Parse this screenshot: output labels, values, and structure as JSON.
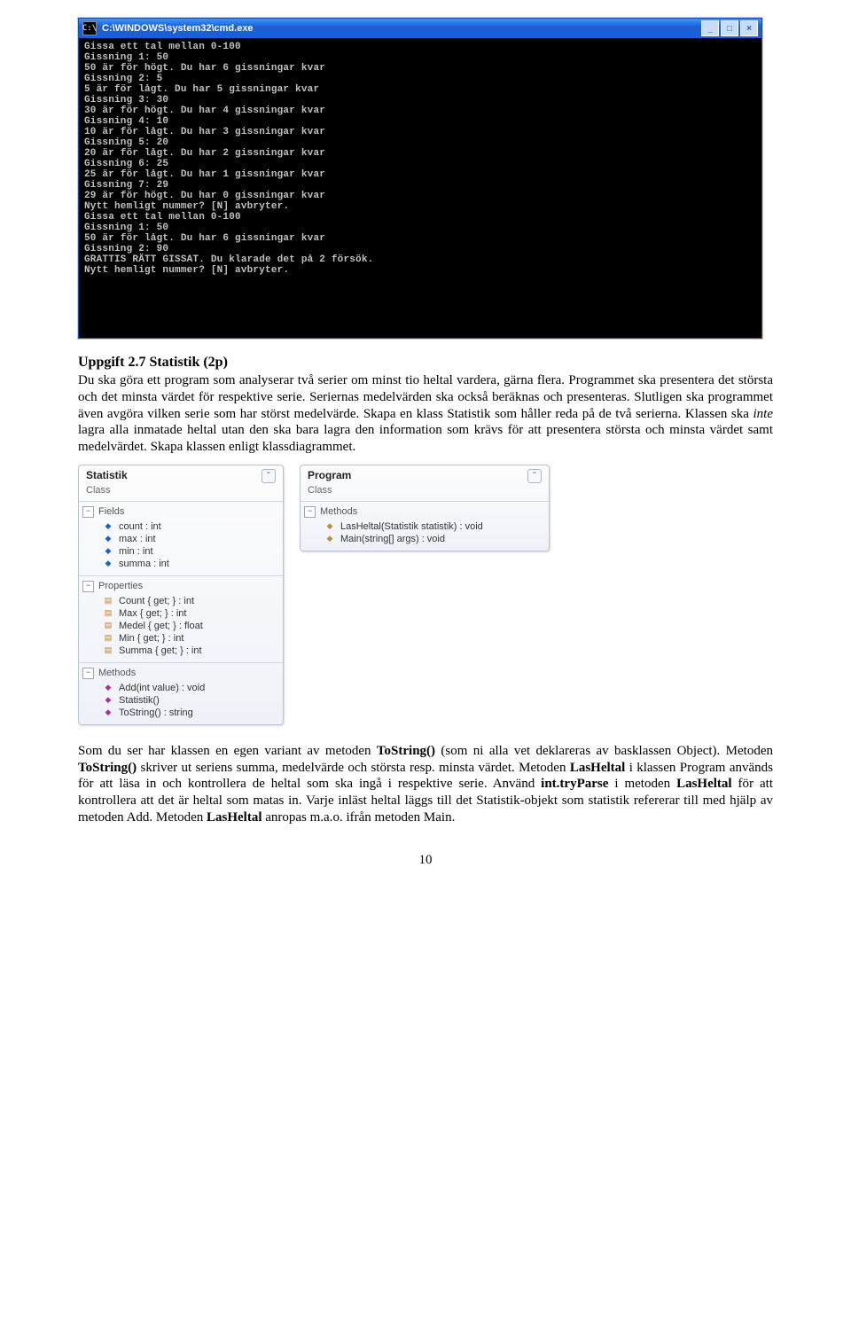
{
  "cmd": {
    "title": "C:\\WINDOWS\\system32\\cmd.exe",
    "icon_glyph": "C:\\",
    "lines": "Gissa ett tal mellan 0-100\nGissning 1: 50\n50 är för högt. Du har 6 gissningar kvar\nGissning 2: 5\n5 är för lågt. Du har 5 gissningar kvar\nGissning 3: 30\n30 är för högt. Du har 4 gissningar kvar\nGissning 4: 10\n10 är för lågt. Du har 3 gissningar kvar\nGissning 5: 20\n20 är för lågt. Du har 2 gissningar kvar\nGissning 6: 25\n25 är för lågt. Du har 1 gissningar kvar\nGissning 7: 29\n29 är för högt. Du har 0 gissningar kvar\nNytt hemligt nummer? [N] avbryter.\nGissa ett tal mellan 0-100\nGissning 1: 50\n50 är för lågt. Du har 6 gissningar kvar\nGissning 2: 90\nGRATTIS RÄTT GISSAT. Du klarade det på 2 försök.\nNytt hemligt nummer? [N] avbryter."
  },
  "heading": "Uppgift 2.7 Statistik (2p)",
  "para1_before": "Du ska göra ett program som analyserar två serier om minst tio heltal vardera, gärna flera. Programmet ska presentera det största och det minsta värdet för respektive serie. Seriernas medelvärden ska också beräknas och presenteras. Slutligen ska programmet även avgöra vilken serie som har störst medelvärde. Skapa en klass Statistik som håller reda på de två serierna. Klassen ska ",
  "para1_italic": "inte",
  "para1_after": " lagra alla inmatade heltal utan den ska bara lagra den information som krävs för att presentera största och minsta värdet samt medelvärdet. Skapa klassen enligt klassdiagrammet.",
  "class1": {
    "name": "Statistik",
    "type": "Class",
    "sections": {
      "fields_label": "Fields",
      "fields": [
        "count : int",
        "max : int",
        "min : int",
        "summa : int"
      ],
      "props_label": "Properties",
      "props": [
        "Count { get; } : int",
        "Max { get; } : int",
        "Medel { get; } : float",
        "Min { get; } : int",
        "Summa { get; } : int"
      ],
      "methods_label": "Methods",
      "methods": [
        {
          "kind": "public",
          "sig": "Add(int value) : void"
        },
        {
          "kind": "public",
          "sig": "Statistik()"
        },
        {
          "kind": "public",
          "sig": "ToString() : string"
        }
      ]
    }
  },
  "class2": {
    "name": "Program",
    "type": "Class",
    "sections": {
      "methods_label": "Methods",
      "methods": [
        {
          "kind": "private",
          "sig": "LasHeltal(Statistik statistik) : void"
        },
        {
          "kind": "private",
          "sig": "Main(string[] args) : void"
        }
      ]
    }
  },
  "para2": {
    "t0": "Som du ser har klassen en egen variant av metoden ",
    "b0": "ToString()",
    "t1": " (som ni alla vet deklareras av basklassen Object). Metoden ",
    "b1": "ToString()",
    "t2": " skriver ut seriens summa, medelvärde och största resp. minsta värdet. Metoden ",
    "b2": "LasHeltal",
    "t3": " i klassen Program används för att läsa in och kontrollera de heltal som ska ingå i respektive serie. Använd ",
    "b3": "int.tryParse",
    "t4": " i metoden ",
    "b4": "LasHeltal",
    "t5": " för att kontrollera att det är heltal som matas in. Varje inläst heltal läggs till det Statistik-objekt som statistik refererar till med hjälp av metoden Add. Metoden ",
    "b5": "LasHeltal",
    "t6": " anropas m.a.o. ifrån metoden Main."
  },
  "pagenum": "10"
}
